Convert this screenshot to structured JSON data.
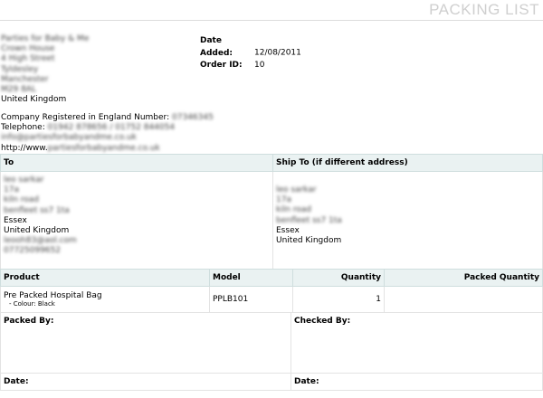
{
  "header": {
    "title": "PACKING LIST"
  },
  "store": {
    "address_lines": [
      "Parties for Baby & Me",
      "Crown House",
      "4 High Street",
      "Tyldesley",
      "Manchester",
      "M29 8AL"
    ],
    "country": "United Kingdom"
  },
  "order": {
    "date_label": "Date Added:",
    "date_value": "12/08/2011",
    "id_label": "Order ID:",
    "id_value": "10"
  },
  "company": {
    "reg_label": "Company Registered in England Number:",
    "reg_value": "07346345",
    "tel_label": "Telephone:",
    "tel_value": "01942 878656 / 01752 844054",
    "email": "info@partiesforbabyandme.co.uk",
    "website_prefix": "http://www.",
    "website_rest": "partiesforbabyandme.co.uk"
  },
  "address": {
    "to_header": "To",
    "ship_header": "Ship To (if different address)",
    "to": {
      "blurred_top": [
        "leo sarkar",
        "17a",
        "kiln road",
        "benfleet ss7 1ta"
      ],
      "county": "Essex",
      "country": "United Kingdom",
      "blurred_bottom": [
        "leooh83@aol.com",
        "07725099652"
      ]
    },
    "ship": {
      "blurred_top": [
        "leo sarkar",
        "17a",
        "kiln road",
        "benfleet ss7 1ta"
      ],
      "county": "Essex",
      "country": "United Kingdom"
    }
  },
  "products": {
    "headers": {
      "product": "Product",
      "model": "Model",
      "quantity": "Quantity",
      "packed": "Packed Quantity"
    },
    "rows": [
      {
        "name": "Pre Packed Hospital Bag",
        "option": "- Colour: Black",
        "model": "PPLB101",
        "quantity": "1",
        "packed": ""
      }
    ]
  },
  "packing": {
    "packed_by": "Packed By:",
    "checked_by": "Checked By:",
    "date_left": "Date:",
    "date_right": "Date:"
  }
}
